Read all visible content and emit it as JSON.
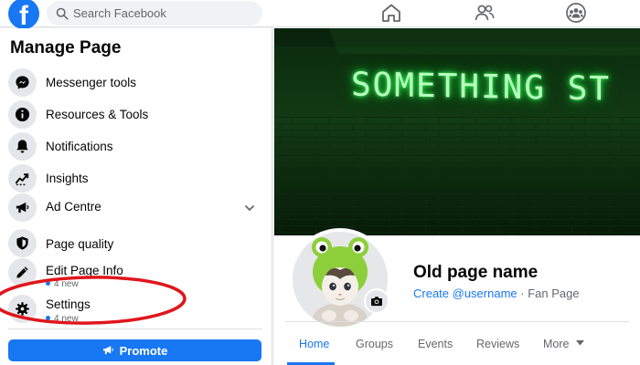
{
  "topbar": {
    "logo": "f",
    "search_placeholder": "Search Facebook",
    "nav_icons": [
      "home-icon",
      "friends-icon",
      "groups-icon"
    ]
  },
  "sidebar": {
    "title": "Manage Page",
    "items": [
      {
        "label": "Messenger tools",
        "icon": "messenger-icon"
      },
      {
        "label": "Resources & Tools",
        "icon": "info-icon"
      },
      {
        "label": "Notifications",
        "icon": "bell-icon"
      },
      {
        "label": "Insights",
        "icon": "trend-chart-icon"
      },
      {
        "label": "Ad Centre",
        "icon": "megaphone-icon",
        "expandable": true
      },
      {
        "label": "Page quality",
        "icon": "shield-icon"
      },
      {
        "label": "Edit Page Info",
        "sub": "4 new",
        "icon": "pencil-icon"
      },
      {
        "label": "Settings",
        "sub": "4 new",
        "icon": "gear-icon"
      }
    ],
    "promote_label": "Promote"
  },
  "cover": {
    "text": "SOMETHING ST"
  },
  "profile": {
    "name": "Old page name",
    "create_username": "Create @username",
    "separator": "·",
    "category": "Fan Page"
  },
  "tabs": [
    {
      "label": "Home",
      "active": true
    },
    {
      "label": "Groups"
    },
    {
      "label": "Events"
    },
    {
      "label": "Reviews"
    },
    {
      "label": "More",
      "dropdown": true
    }
  ],
  "colors": {
    "accent": "#1877f2",
    "annotation": "#e0161b",
    "neon": "#39ff5a"
  }
}
